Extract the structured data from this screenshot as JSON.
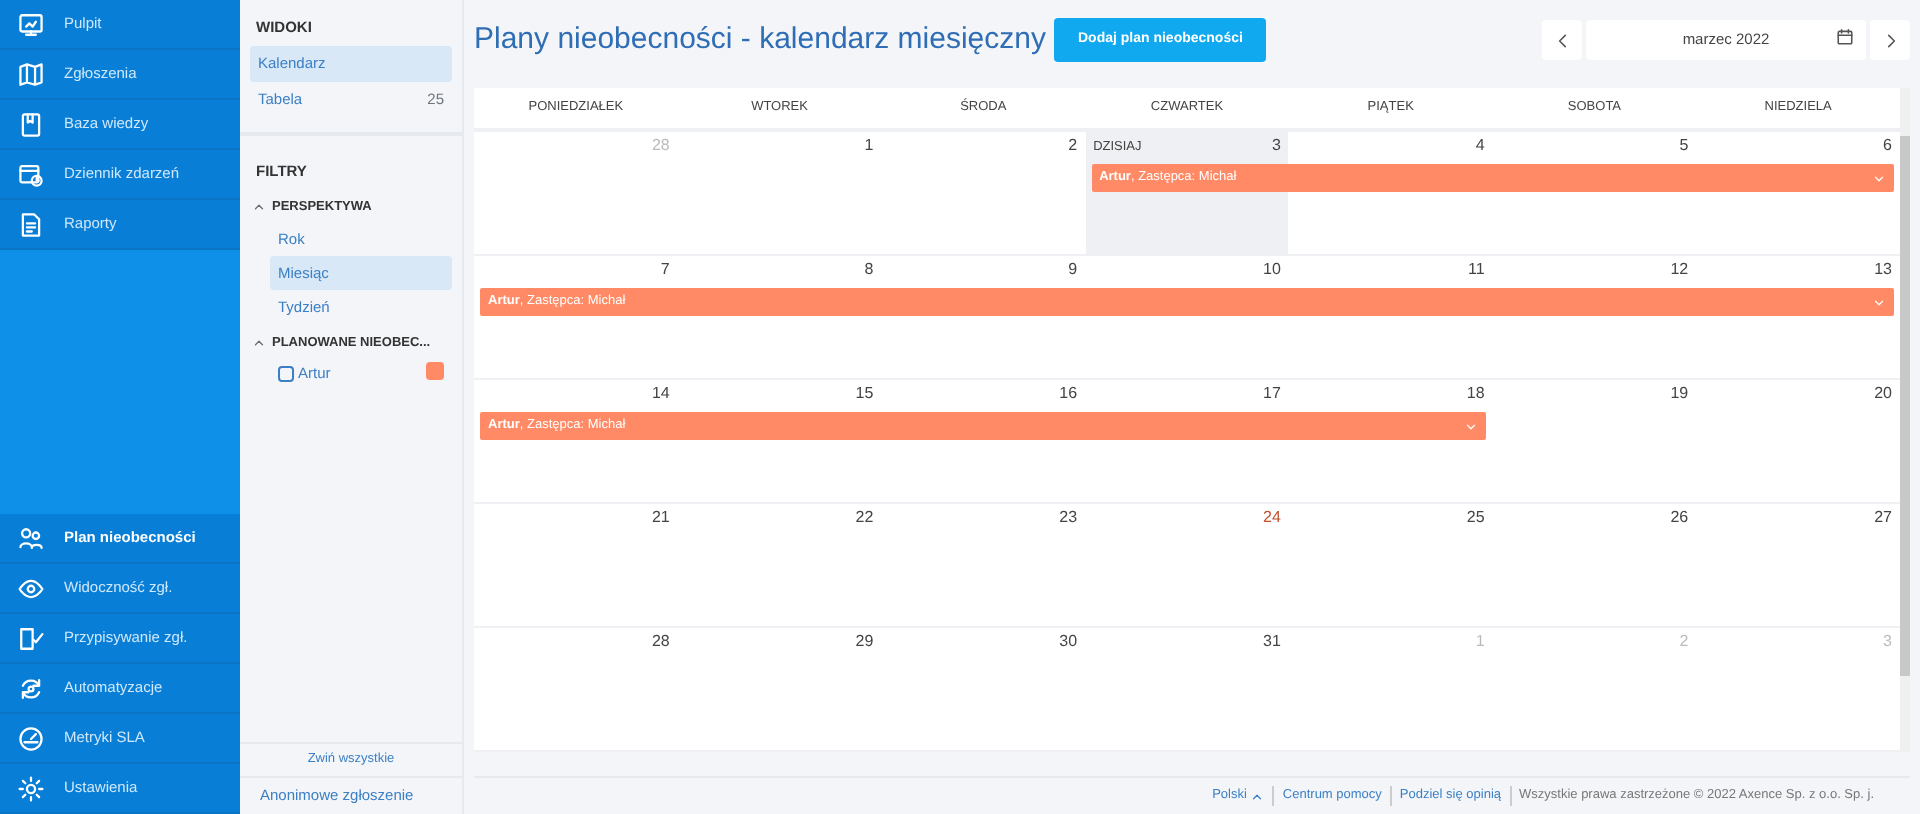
{
  "nav_top": [
    {
      "label": "Pulpit",
      "selected": false
    },
    {
      "label": "Zgłoszenia",
      "selected": false
    },
    {
      "label": "Baza wiedzy",
      "selected": false
    },
    {
      "label": "Dziennik zdarzeń",
      "selected": false
    },
    {
      "label": "Raporty",
      "selected": false
    }
  ],
  "nav_bottom": [
    {
      "label": "Plan nieobecności",
      "selected": true
    },
    {
      "label": "Widoczność zgł.",
      "selected": false
    },
    {
      "label": "Przypisywanie zgł.",
      "selected": false
    },
    {
      "label": "Automatyzacje",
      "selected": false
    },
    {
      "label": "Metryki SLA",
      "selected": false
    },
    {
      "label": "Ustawienia",
      "selected": false
    }
  ],
  "views": {
    "title": "WIDOKI",
    "items": [
      {
        "label": "Kalendarz",
        "selected": true
      },
      {
        "label": "Tabela",
        "count": "25",
        "selected": false
      }
    ]
  },
  "filters": {
    "title": "FILTRY",
    "groups": [
      {
        "title": "PERSPEKTYWA",
        "expanded": true,
        "kind": "options",
        "items": [
          {
            "label": "Rok",
            "selected": false
          },
          {
            "label": "Miesiąc",
            "selected": true
          },
          {
            "label": "Tydzień",
            "selected": false
          }
        ]
      },
      {
        "title": "PLANOWANE NIEOBEC...",
        "expanded": true,
        "kind": "checks",
        "items": [
          {
            "label": "Artur",
            "checked": false,
            "color": "#ff8a65"
          }
        ]
      }
    ],
    "collapse_all": "Zwiń wszystkie"
  },
  "anonymous_link": "Anonimowe zgłoszenie",
  "header": {
    "title": "Plany nieobecności - kalendarz miesięczny",
    "add_button": "Dodaj plan nieobecności",
    "month": "marzec 2022"
  },
  "calendar": {
    "weekdays": [
      "PONIEDZIAŁEK",
      "WTOREK",
      "ŚRODA",
      "CZWARTEK",
      "PIĄTEK",
      "SOBOTA",
      "NIEDZIELA"
    ],
    "weeks": [
      {
        "days": [
          {
            "day": "28",
            "muted": true
          },
          {
            "day": "1"
          },
          {
            "day": "2"
          },
          {
            "day": "3",
            "today": true,
            "today_label": "DZISIAJ",
            "event": "**Artur**, Zastępca: Michał"
          },
          {
            "day": "4",
            "continues": true
          },
          {
            "day": "5",
            "continues": true
          },
          {
            "day": "6",
            "continues": true
          }
        ]
      },
      {
        "days": [
          {
            "day": "7",
            "event": "**Artur**, Zastępca: Michał"
          },
          {
            "day": "8",
            "continues": true
          },
          {
            "day": "9",
            "continues": true
          },
          {
            "day": "10",
            "continues": true
          },
          {
            "day": "11",
            "continues": true
          },
          {
            "day": "12",
            "continues": true
          },
          {
            "day": "13",
            "continues": true
          }
        ]
      },
      {
        "days": [
          {
            "day": "14",
            "event": "**Artur**, Zastępca: Michał"
          },
          {
            "day": "15",
            "continues": true
          },
          {
            "day": "16",
            "continues": true
          },
          {
            "day": "17",
            "continues": true
          },
          {
            "day": "18",
            "continues": true
          },
          {
            "day": "19"
          },
          {
            "day": "20"
          }
        ]
      },
      {
        "days": [
          {
            "day": "21"
          },
          {
            "day": "22"
          },
          {
            "day": "23"
          },
          {
            "day": "24",
            "holiday": true
          },
          {
            "day": "25"
          },
          {
            "day": "26"
          },
          {
            "day": "27"
          }
        ]
      },
      {
        "days": [
          {
            "day": "28"
          },
          {
            "day": "29"
          },
          {
            "day": "30"
          },
          {
            "day": "31"
          },
          {
            "day": "1",
            "muted": true
          },
          {
            "day": "2",
            "muted": true
          },
          {
            "day": "3",
            "muted": true
          }
        ]
      }
    ]
  },
  "footer": {
    "language": "Polski",
    "links": [
      "Centrum pomocy",
      "Podziel się opinią"
    ],
    "copyright": "Wszystkie prawa zastrzeżone © 2022 Axence Sp. z o.o. Sp. j."
  }
}
